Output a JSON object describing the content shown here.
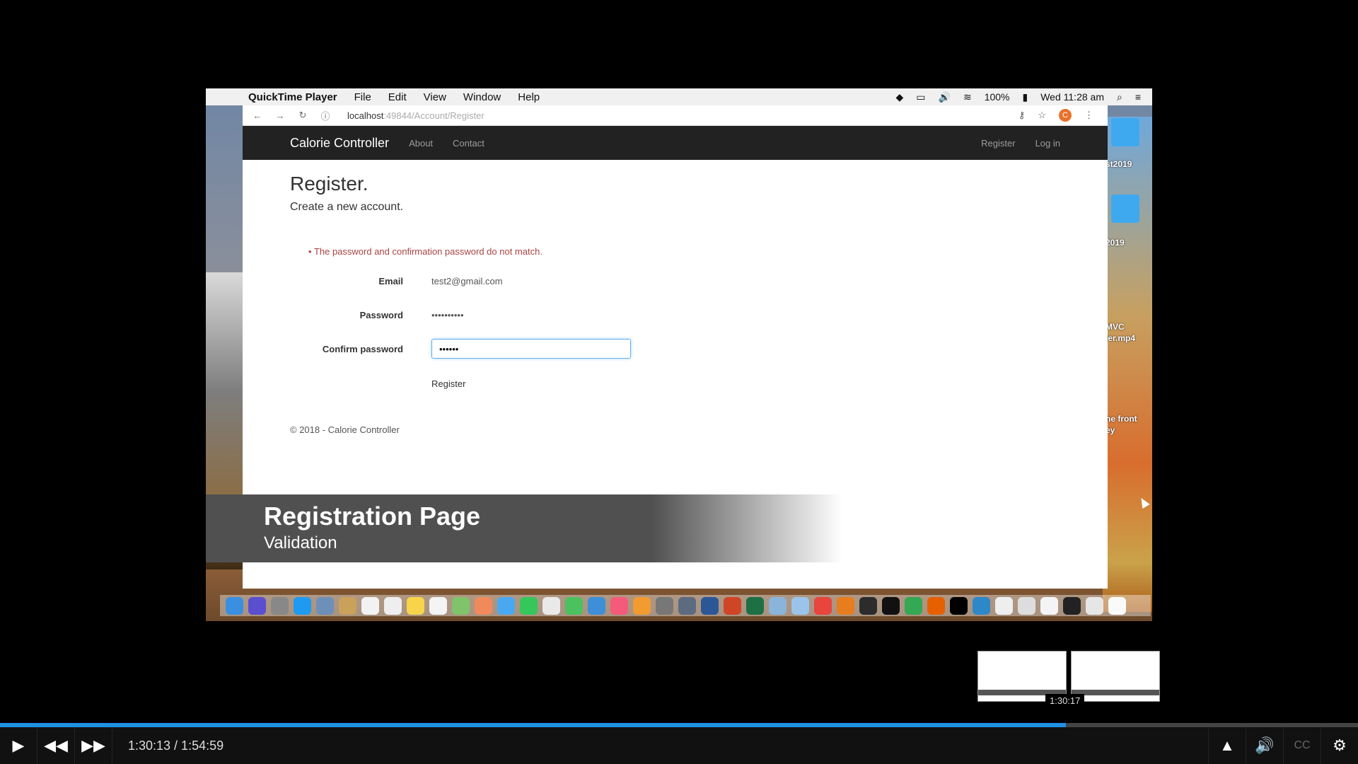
{
  "menubar": {
    "app_name": "QuickTime Player",
    "menus": [
      "File",
      "Edit",
      "View",
      "Window",
      "Help"
    ],
    "battery": "100%",
    "clock": "Wed 11:28 am"
  },
  "browser": {
    "url_host": "localhost",
    "url_path": ":49844/Account/Register",
    "avatar_letter": "C"
  },
  "site": {
    "brand": "Calorie Controller",
    "nav_left": [
      "About",
      "Contact"
    ],
    "nav_right": [
      "Register",
      "Log in"
    ]
  },
  "page": {
    "title": "Register.",
    "subtitle": "Create a new account.",
    "error": "The password and confirmation password do not match.",
    "email_label": "Email",
    "email_value": "test2@gmail.com",
    "password_label": "Password",
    "password_value": "••••••••••",
    "confirm_label": "Confirm password",
    "confirm_value": "••••••",
    "register_button": "Register",
    "footer": "© 2018 - Calorie Controller"
  },
  "caption": {
    "title": "Registration Page",
    "subtitle": "Validation"
  },
  "desktop": {
    "labels": [
      "st2019",
      "2019",
      "MVC",
      "ler.mp4",
      "he front",
      "ey"
    ]
  },
  "player": {
    "time": "1:30:13 / 1:54:59",
    "preview_time": "1:30:17",
    "progress": 0.785,
    "cc_label": "CC",
    "accent": "#1e90e6"
  }
}
